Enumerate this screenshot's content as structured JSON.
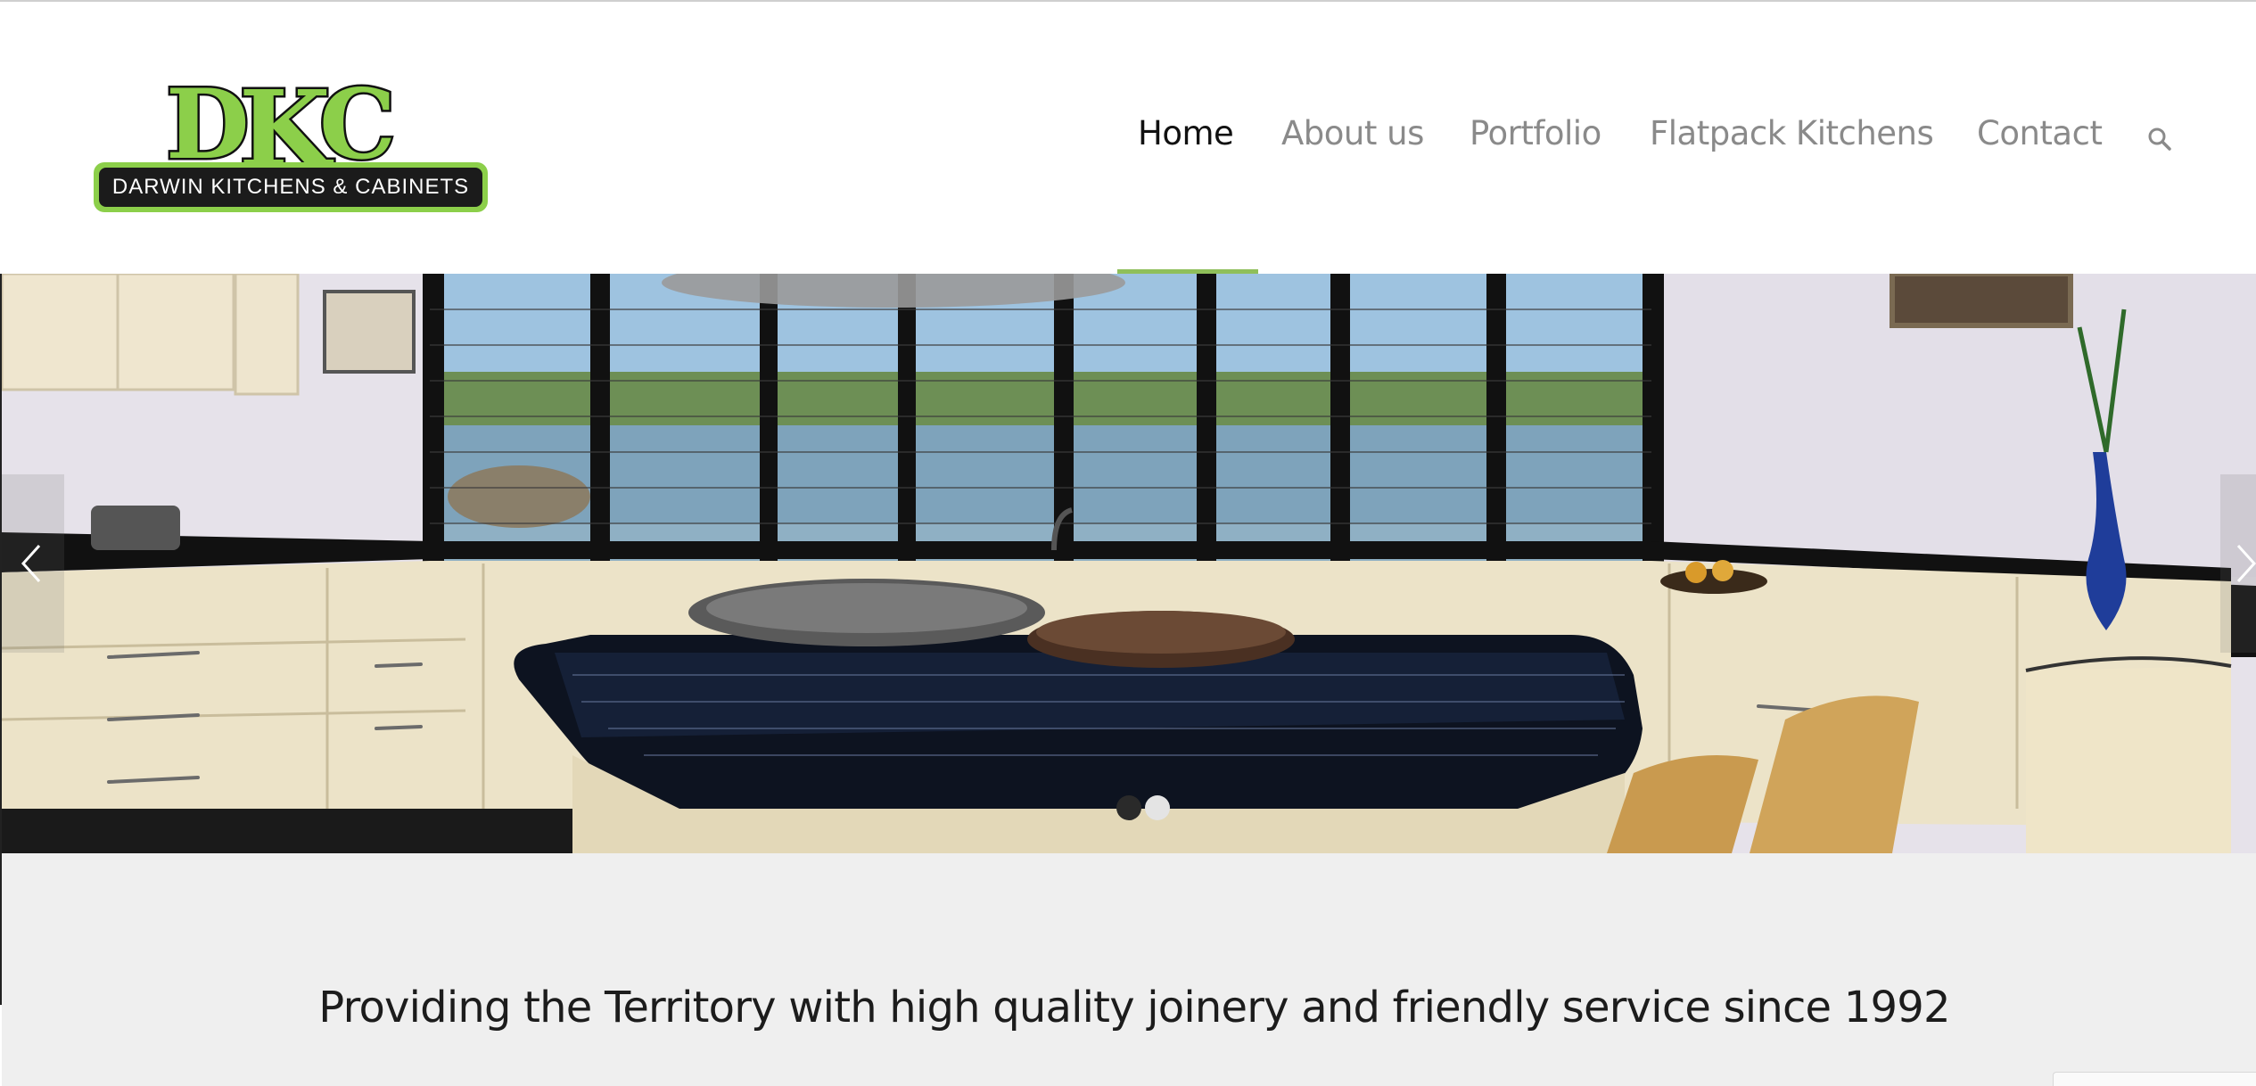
{
  "brand": {
    "logo_letters": "DKC",
    "logo_tagline": "DARWIN KITCHENS & CABINETS",
    "accent_green": "#8ccf4a",
    "nav_underline_color": "#8fbf5a"
  },
  "nav": {
    "items": [
      {
        "label": "Home",
        "active": true
      },
      {
        "label": "About us",
        "active": false
      },
      {
        "label": "Portfolio",
        "active": false
      },
      {
        "label": "Flatpack Kitchens",
        "active": false
      },
      {
        "label": "Contact",
        "active": false
      }
    ],
    "search_icon": "search-icon"
  },
  "slider": {
    "slide_count": 2,
    "active_slide": 1,
    "prev_icon": "chevron-left-icon",
    "next_icon": "chevron-right-icon"
  },
  "tagline": "Providing the Territory with high quality joinery and friendly service since 1992",
  "corner_badge": {
    "text": "... "
  }
}
